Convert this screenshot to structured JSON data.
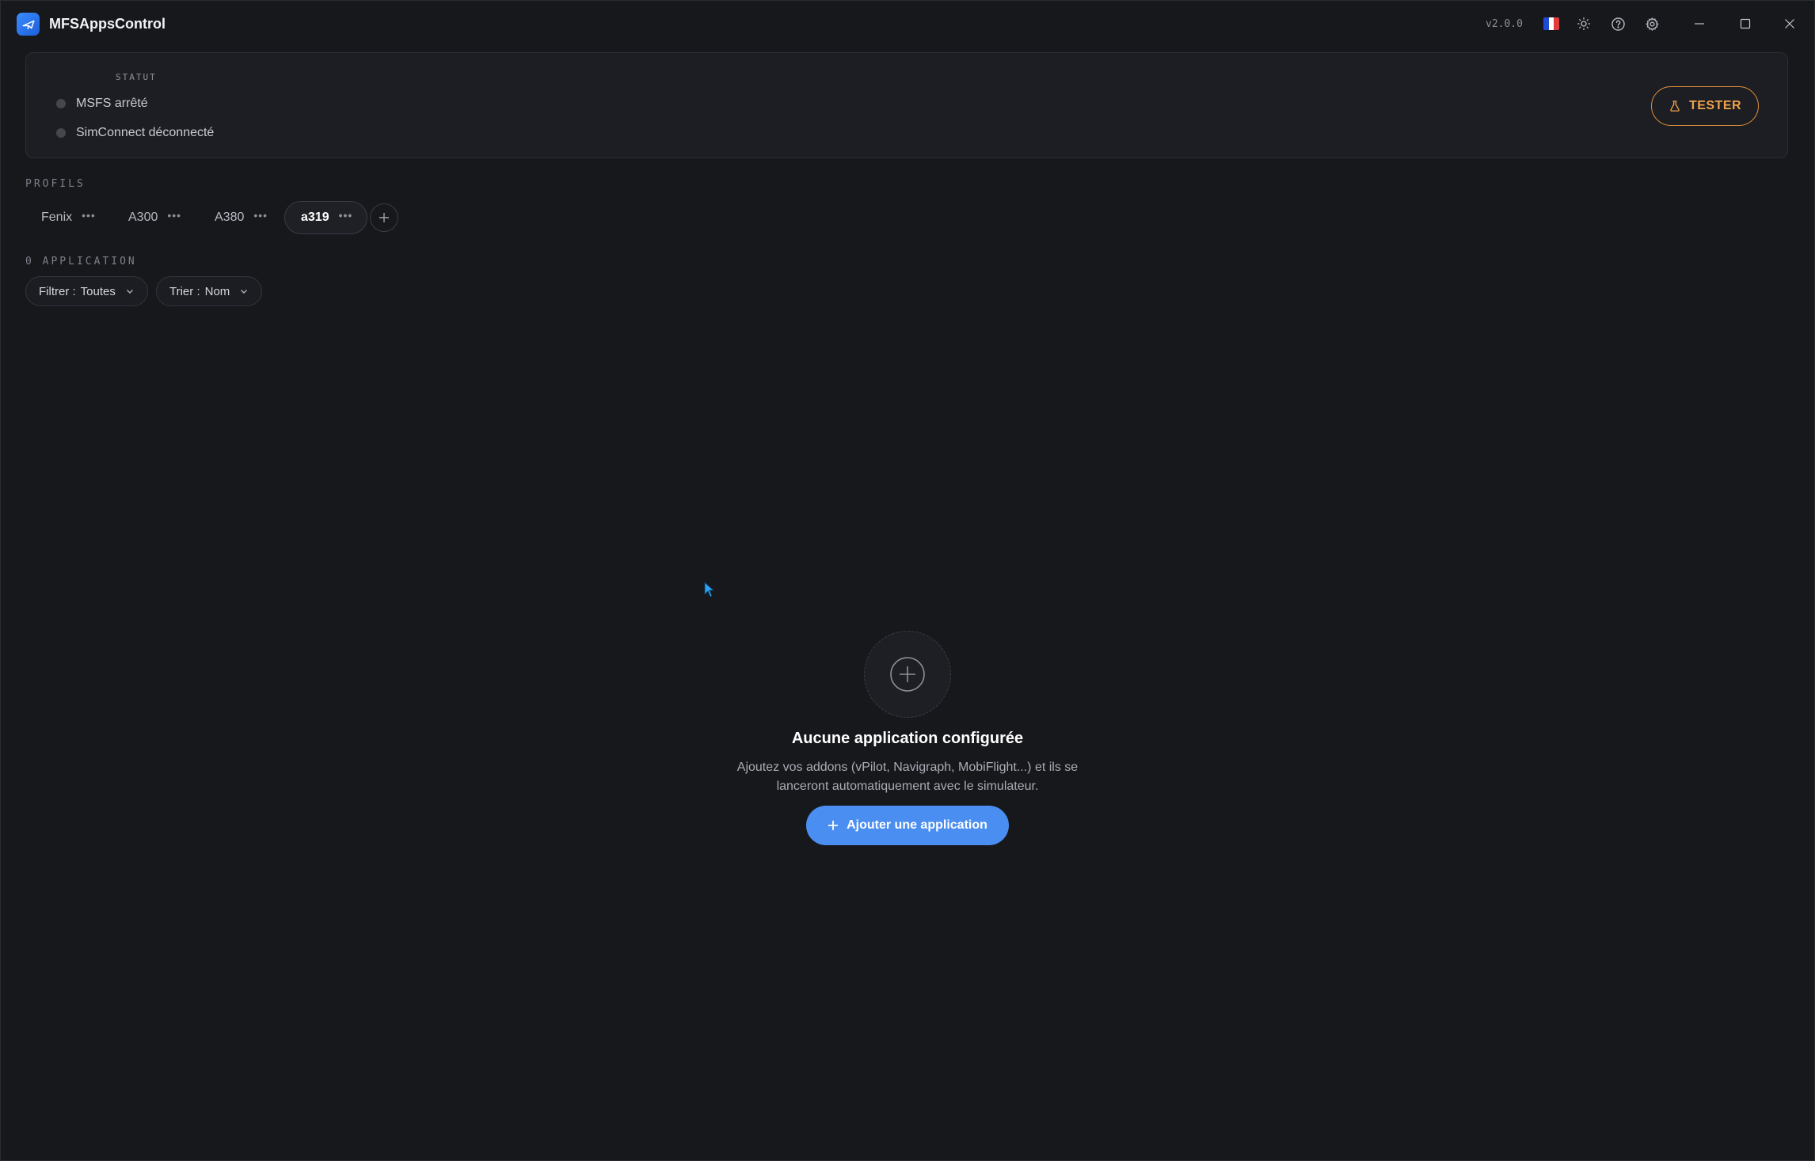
{
  "app": {
    "title": "MFSAppsControl",
    "version": "v2.0.0"
  },
  "titlebar_icons": [
    "flag-fr-icon",
    "sun-icon",
    "help-icon",
    "gear-icon",
    "minimize-icon",
    "maximize-icon",
    "close-icon"
  ],
  "status": {
    "heading": "STATUT",
    "items": [
      {
        "text": "MSFS arrêté",
        "state": "off"
      },
      {
        "text": "SimConnect déconnecté",
        "state": "off"
      }
    ],
    "test_button": {
      "label": "TESTER",
      "icon": "flask-icon",
      "color": "#f0a24b"
    }
  },
  "profiles": {
    "heading": "PROFILS",
    "tabs": [
      {
        "label": "Fenix",
        "active": false
      },
      {
        "label": "A300",
        "active": false
      },
      {
        "label": "A380",
        "active": false
      },
      {
        "label": "a319",
        "active": true
      }
    ],
    "menu_glyph": "•••",
    "add_icon": "plus-icon"
  },
  "applications": {
    "heading": "0 APPLICATION",
    "filter": {
      "prefix": "Filtrer :",
      "value": "Toutes"
    },
    "sort": {
      "prefix": "Trier :",
      "value": "Nom"
    }
  },
  "empty_state": {
    "icon": "plus-circle-icon",
    "title": "Aucune application configurée",
    "description_line1": "Ajoutez vos addons (vPilot, Navigraph, MobiFlight...) et ils se",
    "description_line2": "lanceront automatiquement avec le simulateur.",
    "button_label": "Ajouter une application"
  },
  "colors": {
    "background": "#17181c",
    "card": "#1d1e23",
    "accent_blue": "#4a8ef2",
    "accent_orange": "#f0a24b"
  }
}
